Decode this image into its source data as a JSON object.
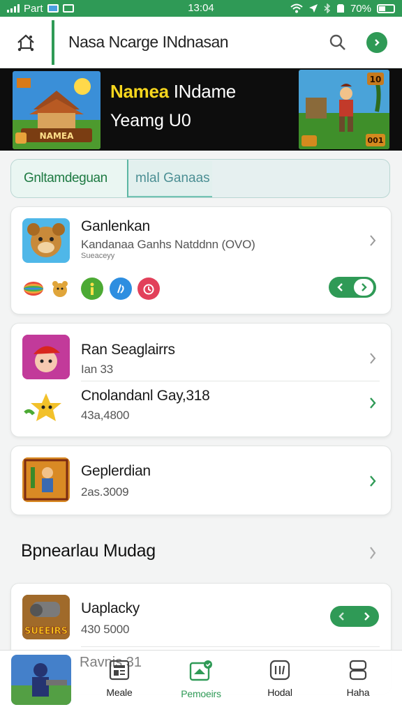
{
  "status": {
    "carrier": "Part",
    "time": "13:04",
    "battery": "70%"
  },
  "header": {
    "title": "Nasa Ncarge INdnasan"
  },
  "banner": {
    "line1_yellow": "Namea",
    "line1_white": "INdame",
    "line2": "Yeamg U0",
    "left_art_caption": "NAMEA",
    "right_art_badge_top": "10",
    "right_art_badge_bottom": "001"
  },
  "tabs": {
    "active": "Gnltamdeguan",
    "inactive": "mlal Ganaas"
  },
  "cards": [
    {
      "rows": [
        {
          "title": "Ganlenkan",
          "subtitle": "Kandanaa Ganhs Natddnn (OVO)",
          "tiny": "Sueaceyy"
        }
      ]
    },
    {
      "rows": [
        {
          "title": "Ran Seaglairrs",
          "subtitle": "Ian 33"
        },
        {
          "title": "Cnolandanl Gay,318",
          "subtitle": "43a,4800"
        }
      ]
    },
    {
      "rows": [
        {
          "title": "Geplerdian",
          "subtitle": "2as.3009"
        }
      ]
    }
  ],
  "section": {
    "title": "Bpnearlau Mudag"
  },
  "section_card": {
    "rows": [
      {
        "title": "Uaplacky",
        "subtitle": "430 5000",
        "thumb_caption": "SUEEIRS"
      },
      {
        "title": "Ravnis 31"
      }
    ]
  },
  "nav": [
    {
      "label": "Meale"
    },
    {
      "label": "Pemoeirs"
    },
    {
      "label": "Hodal"
    },
    {
      "label": "Haha"
    }
  ],
  "colors": {
    "accent": "#2f9a56",
    "banner_bg": "#0d0d0d",
    "banner_yellow": "#f6d61e"
  }
}
